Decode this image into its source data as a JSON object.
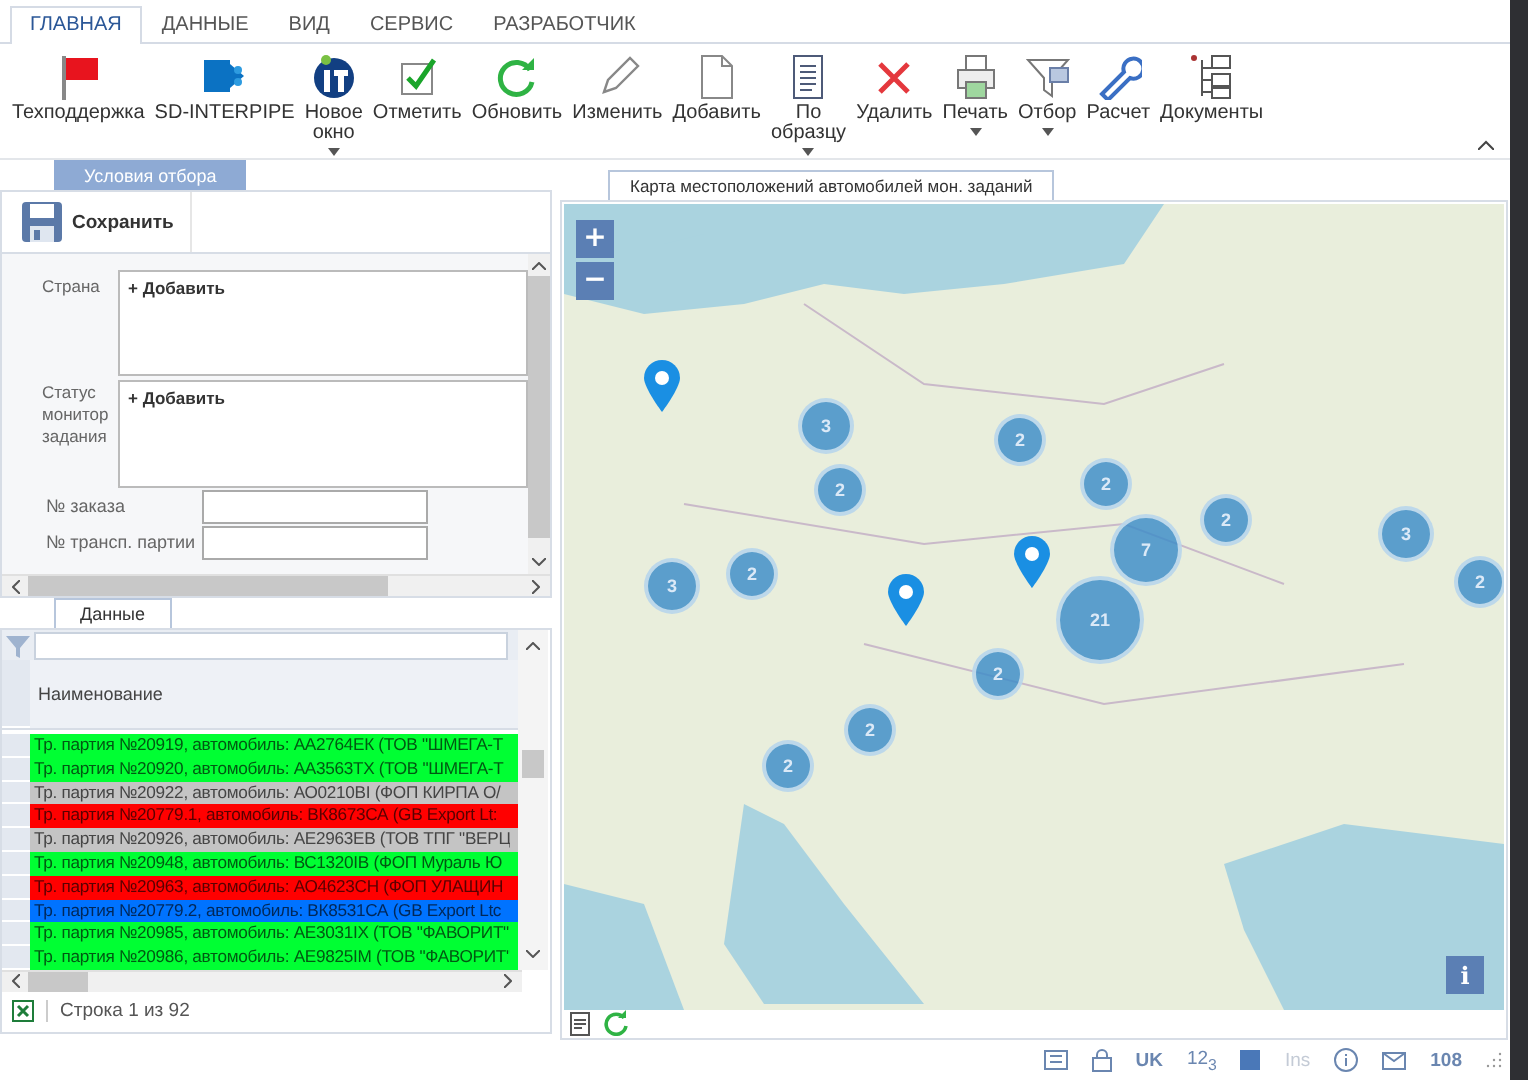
{
  "tabs": [
    {
      "label": "ГЛАВНАЯ",
      "selected": true
    },
    {
      "label": "ДАННЫЕ",
      "selected": false
    },
    {
      "label": "ВИД",
      "selected": false
    },
    {
      "label": "СЕРВИС",
      "selected": false
    },
    {
      "label": "РАЗРАБОТЧИК",
      "selected": false
    }
  ],
  "ribbon": {
    "buttons": [
      {
        "kind": "flag",
        "label": "Техподдержка",
        "dropdown": false
      },
      {
        "kind": "share",
        "label": "SD-INTERPIPE",
        "dropdown": false
      },
      {
        "kind": "logo",
        "label": "Новое\nокно",
        "dropdown": true
      },
      {
        "kind": "check",
        "label": "Отметить",
        "dropdown": false
      },
      {
        "kind": "refresh",
        "label": "Обновить",
        "dropdown": false
      },
      {
        "kind": "pencil",
        "label": "Изменить",
        "dropdown": false
      },
      {
        "kind": "page",
        "label": "Добавить",
        "dropdown": false
      },
      {
        "kind": "lines",
        "label": "По\nобразцу",
        "dropdown": true
      },
      {
        "kind": "cross",
        "label": "Удалить",
        "dropdown": false
      },
      {
        "kind": "printer",
        "label": "Печать",
        "dropdown": true
      },
      {
        "kind": "funnel",
        "label": "Отбор",
        "dropdown": true
      },
      {
        "kind": "wrench",
        "label": "Расчет",
        "dropdown": false
      },
      {
        "kind": "tree",
        "label": "Документы",
        "dropdown": false
      }
    ]
  },
  "filter_panel": {
    "tab": {
      "label": "Условия отбора",
      "selected": true
    },
    "save_button": "Сохранить",
    "fields": [
      {
        "kind": "list",
        "label": "Страна",
        "add_label": "+ Добавить"
      },
      {
        "kind": "list",
        "label": "Статус\nмонитор\nзадания",
        "add_label": "+ Добавить"
      },
      {
        "kind": "input",
        "label": "№ заказа"
      },
      {
        "kind": "input",
        "label": "№ трансп. партии"
      }
    ]
  },
  "grid_panel": {
    "tab": {
      "label": "Данные",
      "selected": true
    },
    "columns": [
      "Наименование"
    ],
    "rows": [
      {
        "name": "Тр. партия №20919, автомобиль: АА2764ЕК (ТОВ \"ШМЕГА-Т",
        "color": "#00ff33"
      },
      {
        "name": "Тр. партия №20920, автомобиль: АА3563ТХ (ТОВ \"ШМЕГА-Т",
        "color": "#00ff33"
      },
      {
        "name": "Тр. партия №20922, автомобиль: АО0210ВІ (ФОП КИРПА О/",
        "color": "#c4c4c4"
      },
      {
        "name": "Тр. партия №20779.1, автомобиль: ВК8673СА (GB Export Lt:",
        "color": "#ff0000"
      },
      {
        "name": "Тр. партия №20926, автомобиль: АЕ2963ЕВ (ТОВ ТПГ \"ВЕРЦ",
        "color": "#c4c4c4"
      },
      {
        "name": "Тр. партия №20948, автомобиль: ВС1320ІВ (ФОП Мураль Ю",
        "color": "#00ff33"
      },
      {
        "name": "Тр. партия №20963, автомобиль: АО4623СН (ФОП УЛАЩИН",
        "color": "#ff0000"
      },
      {
        "name": "Тр. партия №20779.2, автомобиль: ВК8531СА (GB Export Ltc",
        "color": "#0073ff"
      },
      {
        "name": "Тр. партия №20985, автомобиль: АЕ3031ІХ (ТОВ \"ФАВОРИТ\"",
        "color": "#00ff33"
      },
      {
        "name": "Тр. партия №20986, автомобиль: АЕ9825ІМ (ТОВ \"ФАВОРИТ\"",
        "color": "#00ff33"
      }
    ],
    "footer": "Строка 1 из 92"
  },
  "map_panel": {
    "tab": {
      "label": "Карта местоположений автомобилей мон. заданий",
      "selected": true
    },
    "zoom_in": "+",
    "zoom_out": "−",
    "info": "i",
    "clusters": [
      {
        "count": "3"
      },
      {
        "count": "2"
      },
      {
        "count": "2"
      },
      {
        "count": "2"
      },
      {
        "count": "3"
      },
      {
        "count": "2"
      },
      {
        "count": "2"
      },
      {
        "count": "7"
      },
      {
        "count": "3"
      },
      {
        "count": "21"
      },
      {
        "count": "2"
      },
      {
        "count": "2"
      },
      {
        "count": "2"
      },
      {
        "count": "2"
      }
    ]
  },
  "status_bar": {
    "language": "UK",
    "number_mode": "12$_{3}$",
    "insert_mode": {
      "label": "Ins",
      "on": false
    },
    "messages": "108"
  }
}
